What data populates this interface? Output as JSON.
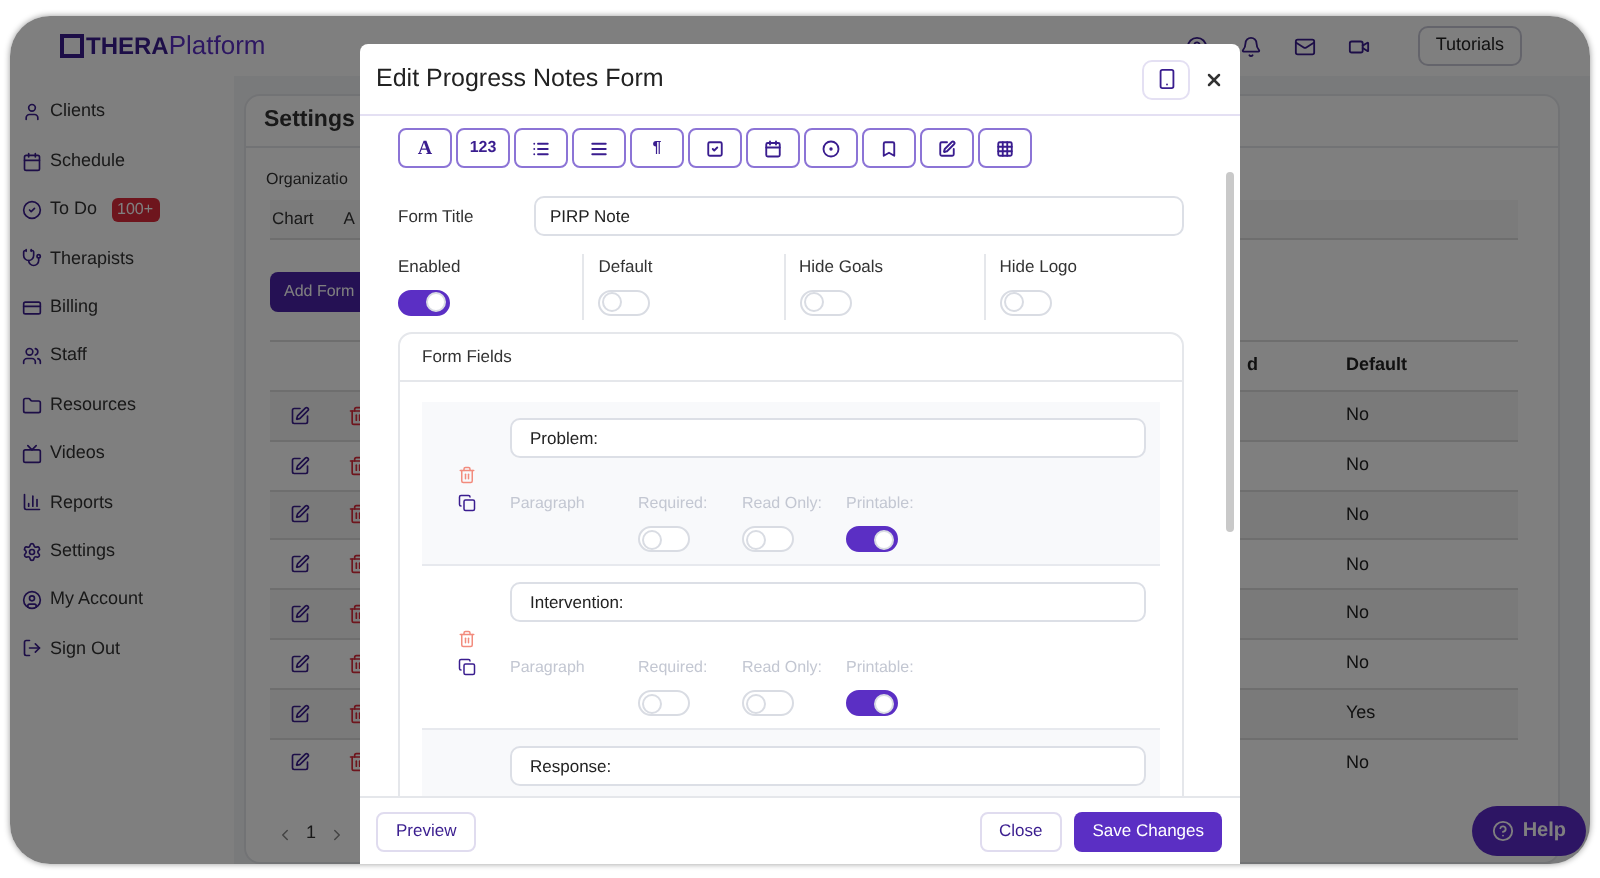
{
  "header": {
    "logo": {
      "bold": "THERA",
      "light": "Platform"
    },
    "tutorials_button": "Tutorials"
  },
  "sidebar": {
    "items": [
      {
        "label": "Clients"
      },
      {
        "label": "Schedule"
      },
      {
        "label": "To Do",
        "badge": "100+"
      },
      {
        "label": "Therapists"
      },
      {
        "label": "Billing"
      },
      {
        "label": "Staff"
      },
      {
        "label": "Resources"
      },
      {
        "label": "Videos"
      },
      {
        "label": "Reports"
      },
      {
        "label": "Settings"
      },
      {
        "label": "My Account"
      },
      {
        "label": "Sign Out"
      }
    ]
  },
  "settings_card": {
    "title": "Settings",
    "section_title": "Organizatio",
    "tabs": [
      {
        "label": "Chart"
      },
      {
        "label": "A"
      }
    ],
    "add_button": "Add Form",
    "table": {
      "columns": [
        "d",
        "Default"
      ],
      "rows": [
        {
          "default": "No"
        },
        {
          "default": "No"
        },
        {
          "default": "No"
        },
        {
          "default": "No"
        },
        {
          "default": "No"
        },
        {
          "default": "No"
        },
        {
          "default": "Yes"
        },
        {
          "default": "No"
        }
      ]
    },
    "pagination": {
      "page": "1"
    }
  },
  "modal": {
    "title": "Edit Progress Notes Form",
    "toolbar": [
      {
        "kind": "text",
        "label": "A"
      },
      {
        "kind": "text",
        "label": "123"
      },
      {
        "kind": "icon"
      },
      {
        "kind": "icon"
      },
      {
        "kind": "text",
        "label": "¶"
      },
      {
        "kind": "icon"
      },
      {
        "kind": "icon"
      },
      {
        "kind": "icon"
      },
      {
        "kind": "icon"
      },
      {
        "kind": "icon"
      },
      {
        "kind": "icon"
      }
    ],
    "form_title": {
      "label": "Form Title",
      "value": "PIRP Note"
    },
    "toggles": [
      {
        "label": "Enabled",
        "on": true
      },
      {
        "label": "Default",
        "on": false
      },
      {
        "label": "Hide Goals",
        "on": false
      },
      {
        "label": "Hide Logo",
        "on": false
      }
    ],
    "form_fields": {
      "title": "Form Fields",
      "fields": [
        {
          "name": "Problem:",
          "type": "Paragraph",
          "switches": [
            {
              "label": "Required:",
              "on": false
            },
            {
              "label": "Read Only:",
              "on": false
            },
            {
              "label": "Printable:",
              "on": true
            }
          ]
        },
        {
          "name": "Intervention:",
          "type": "Paragraph",
          "switches": [
            {
              "label": "Required:",
              "on": false
            },
            {
              "label": "Read Only:",
              "on": false
            },
            {
              "label": "Printable:",
              "on": true
            }
          ]
        },
        {
          "name": "Response:"
        }
      ]
    },
    "buttons": {
      "preview": "Preview",
      "close": "Close",
      "save": "Save Changes"
    }
  },
  "help_button": "Help"
}
